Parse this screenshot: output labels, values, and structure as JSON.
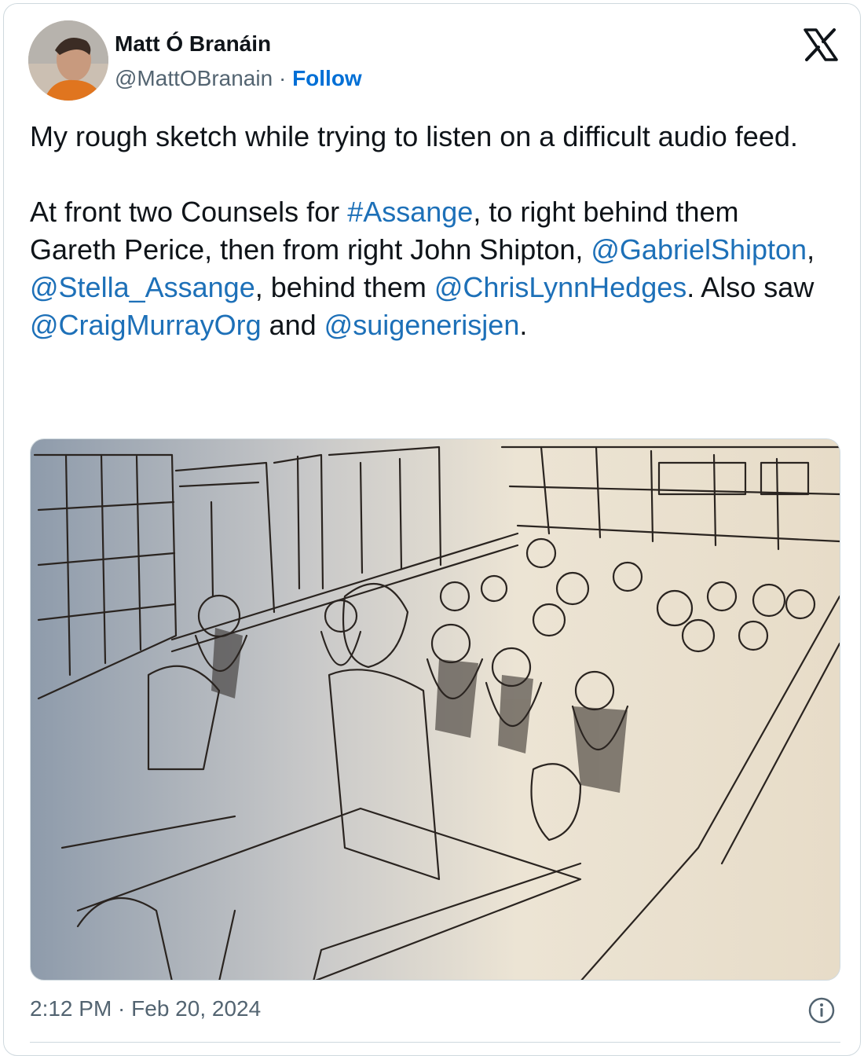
{
  "author": {
    "display_name": "Matt Ó Branáin",
    "handle": "@MattOBranain",
    "separator": " · ",
    "follow_label": "Follow"
  },
  "tweet": {
    "line1": "My rough sketch while trying to listen on a difficult audio feed.",
    "p2_a": "At front two Counsels for ",
    "hashtag": "#Assange",
    "p2_b": ", to right behind them Gareth Perice, then from right John Shipton, ",
    "mention1": "@GabrielShipton",
    "p2_c": ", ",
    "mention2": "@Stella_Assange",
    "p2_d": ", behind them ",
    "mention3": "@ChrisLynnHedges",
    "p2_e": ". Also saw ",
    "mention4": "@CraigMurrayOrg",
    "p2_f": " and ",
    "mention5": "@suigenerisjen",
    "p2_g": "."
  },
  "meta": {
    "timestamp": "2:12 PM · Feb 20, 2024"
  },
  "icons": {
    "brand": "x-logo-icon",
    "info": "info-icon"
  },
  "colors": {
    "link": "#1d70b8",
    "follow": "#006fd6",
    "secondary_text": "#536471",
    "border": "#cfd9de"
  }
}
